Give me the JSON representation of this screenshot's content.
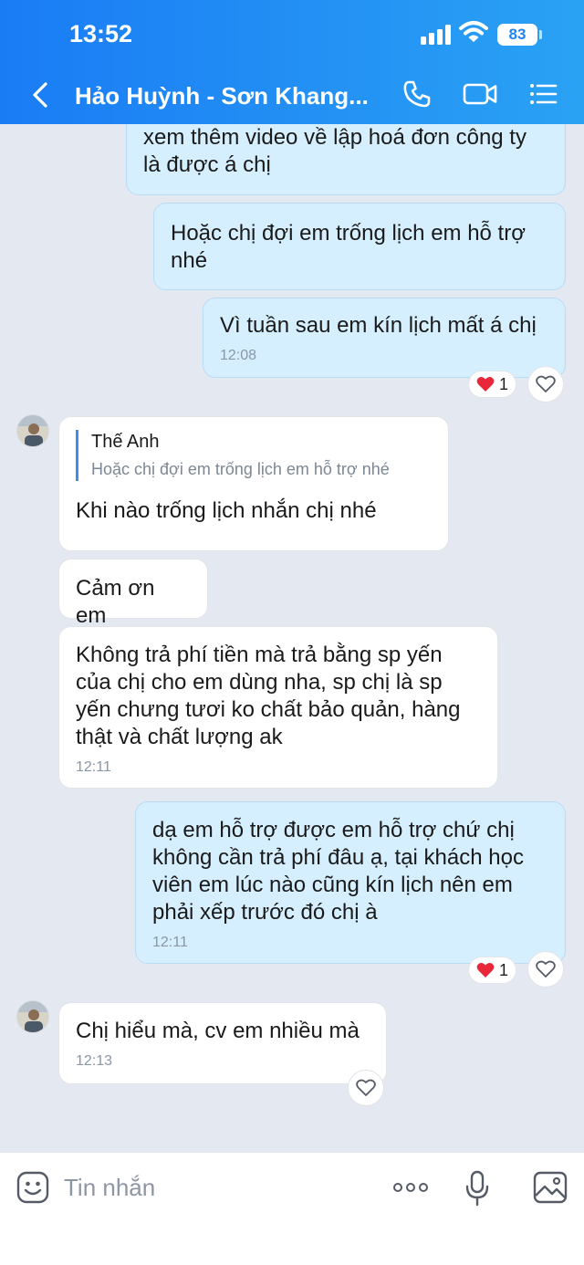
{
  "status_bar": {
    "time": "13:52",
    "battery": "83"
  },
  "header": {
    "title": "Hảo Huỳnh - Sơn Khang..."
  },
  "messages": [
    {
      "direction": "out",
      "text": "xem thêm video về lập hoá đơn công ty\nlà được á chị"
    },
    {
      "direction": "out",
      "text": "Hoặc chị đợi em trống lịch em hỗ trợ\nnhé"
    },
    {
      "direction": "out",
      "text": "Vì tuần sau em kín lịch mất á chị",
      "time": "12:08",
      "reaction": {
        "emoji": "❤️",
        "count": "1"
      }
    },
    {
      "direction": "in",
      "reply": {
        "author": "Thế Anh",
        "text": "Hoặc chị đợi em trống lịch em hỗ trợ nhé"
      },
      "text": "Khi nào trống lịch nhắn chị nhé"
    },
    {
      "direction": "in",
      "text": "Cảm ơn em"
    },
    {
      "direction": "in",
      "text": "Không trả phí tiền mà trả bằng sp yến\ncủa chị cho em dùng nha, sp chị là sp\nyến chưng tươi ko chất bảo quản, hàng\nthật và chất lượng ak",
      "time": "12:11"
    },
    {
      "direction": "out",
      "text": "dạ em hỗ trợ được em hỗ trợ chứ chị\nkhông cần trả phí đâu ạ, tại khách học\nviên em lúc nào cũng kín lịch nên em\nphải xếp trước đó chị à",
      "time": "12:11",
      "reaction": {
        "emoji": "❤️",
        "count": "1"
      }
    },
    {
      "direction": "in",
      "text": "Chị hiểu mà, cv em nhiều mà",
      "time": "12:13"
    }
  ],
  "composer": {
    "placeholder": "Tin nhắn"
  },
  "colors": {
    "header_start": "#1a7cf5",
    "header_end": "#2aa2f4",
    "outgoing_bubble": "#d6efff",
    "incoming_bubble": "#ffffff",
    "chat_bg": "#e4e8f1",
    "heart": "#e8283a"
  },
  "icons": [
    "back-chevron-icon",
    "phone-icon",
    "video-camera-icon",
    "menu-list-icon",
    "heart-icon",
    "like-heart-outline-icon",
    "emoji-sticker-icon",
    "more-dots-icon",
    "microphone-icon",
    "image-gallery-icon"
  ]
}
